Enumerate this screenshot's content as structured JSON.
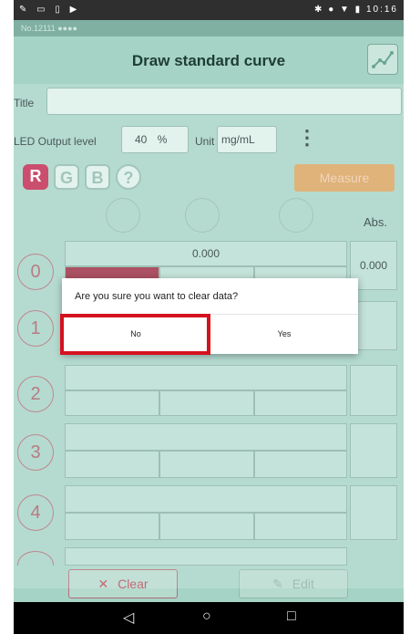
{
  "status": {
    "left_icons": "✎ ▭ ▯ ▶",
    "right": "✱ ● ▼ ▮ 10:16"
  },
  "app_id": "No.12111 ●●●●",
  "toolbar": {
    "title": "Draw standard curve",
    "chart_icon": "chart-line-icon"
  },
  "form": {
    "title_label": "Title",
    "title_value": "",
    "led_label": "LED Output level",
    "led_value": "40",
    "led_unit": "%",
    "unit_label": "Unit",
    "unit_value": "mg/mL",
    "more_glyph": "⋮"
  },
  "color_buttons": [
    {
      "label": "R",
      "color": "#c0284f"
    },
    {
      "label": "G",
      "color": "#8fb9ad"
    },
    {
      "label": "B",
      "color": "#8fb9ad"
    },
    {
      "label": "?",
      "color": "#8fb9ad"
    }
  ],
  "measure_label": "Measure",
  "abs_header": "Abs.",
  "rows": [
    {
      "index": "0",
      "value": "0.000",
      "abs": "0.000"
    },
    {
      "index": "1",
      "value": "",
      "abs": ""
    },
    {
      "index": "2",
      "value": "",
      "abs": ""
    },
    {
      "index": "3",
      "value": "",
      "abs": ""
    },
    {
      "index": "4",
      "value": "",
      "abs": ""
    }
  ],
  "dialog": {
    "message": "Are you sure you want to clear data?",
    "no_label": "No",
    "yes_label": "Yes"
  },
  "bottom": {
    "clear_label": "Clear",
    "clear_icon": "✕",
    "edit_label": "Edit",
    "edit_icon": "✎"
  },
  "nav": {
    "back": "◁",
    "home": "○",
    "recents": "□"
  }
}
